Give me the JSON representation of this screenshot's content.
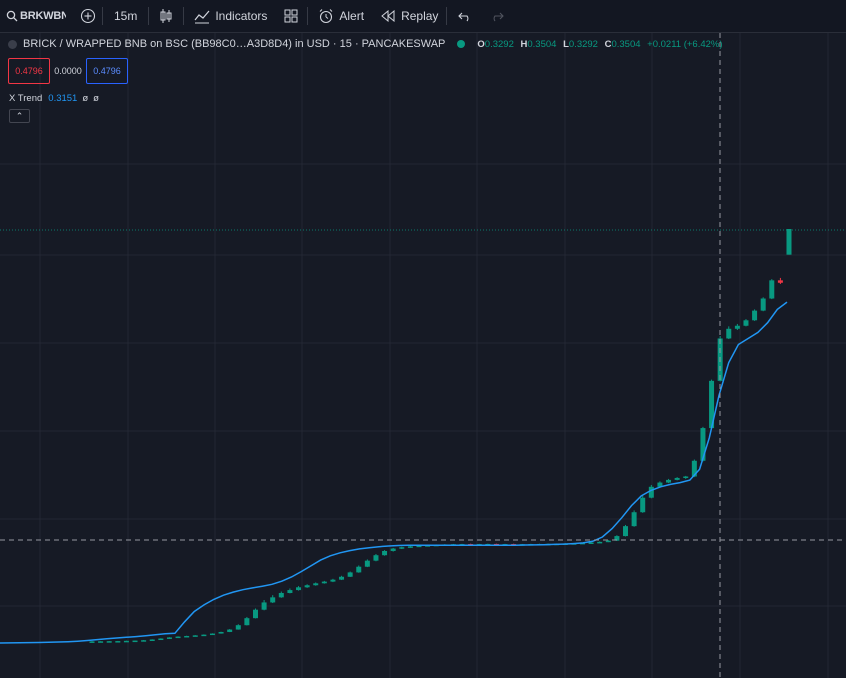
{
  "toolbar": {
    "symbol": "BRKWBNB",
    "interval": "15m",
    "indicators_label": "Indicators",
    "alert_label": "Alert",
    "replay_label": "Replay"
  },
  "legend": {
    "title": "BRICK / WRAPPED BNB on BSC (BB98C0…A3D8D4) in USD · 15 · PANCAKESWAP",
    "open_key": "O",
    "open": "0.3292",
    "high_key": "H",
    "high": "0.3504",
    "low_key": "L",
    "low": "0.3292",
    "close_key": "C",
    "close": "0.3504",
    "change": "+0.0211 (+6.42%)"
  },
  "trade": {
    "sell_price": "0.4796",
    "spread": "0.0000",
    "buy_price": "0.4796"
  },
  "indicator": {
    "name": "X Trend",
    "value": "0.3151",
    "extra1": "ø",
    "extra2": "ø"
  },
  "colors": {
    "up": "#089981",
    "down": "#f23645",
    "trend": "#2196f3",
    "background": "#161a25",
    "grid": "#232733"
  },
  "chart_data": {
    "type": "line",
    "x_unit": "15-minute bars",
    "series": [
      {
        "kind": "candlestick",
        "values": [
          [
            0.0095,
            0.01,
            0.0093,
            0.0098
          ],
          [
            0.0098,
            0.01,
            0.0096,
            0.0099
          ],
          [
            0.0099,
            0.0101,
            0.0097,
            0.01
          ],
          [
            0.01,
            0.0102,
            0.0098,
            0.0101
          ],
          [
            0.0101,
            0.0104,
            0.01,
            0.0103
          ],
          [
            0.0103,
            0.0106,
            0.0102,
            0.0105
          ],
          [
            0.0105,
            0.011,
            0.0104,
            0.0108
          ],
          [
            0.0108,
            0.0116,
            0.0107,
            0.0114
          ],
          [
            0.0114,
            0.0124,
            0.0113,
            0.0122
          ],
          [
            0.0122,
            0.0133,
            0.0121,
            0.0131
          ],
          [
            0.0131,
            0.014,
            0.013,
            0.0138
          ],
          [
            0.0138,
            0.0145,
            0.0137,
            0.0143
          ],
          [
            0.0143,
            0.015,
            0.0142,
            0.0148
          ],
          [
            0.0148,
            0.0156,
            0.0147,
            0.0154
          ],
          [
            0.0154,
            0.0165,
            0.0153,
            0.0163
          ],
          [
            0.0163,
            0.0178,
            0.0162,
            0.0176
          ],
          [
            0.0176,
            0.02,
            0.0175,
            0.0196
          ],
          [
            0.0196,
            0.024,
            0.0195,
            0.0232
          ],
          [
            0.0232,
            0.03,
            0.023,
            0.029
          ],
          [
            0.029,
            0.037,
            0.0288,
            0.036
          ],
          [
            0.036,
            0.044,
            0.0355,
            0.042
          ],
          [
            0.042,
            0.048,
            0.0415,
            0.0462
          ],
          [
            0.0462,
            0.051,
            0.0458,
            0.0498
          ],
          [
            0.0498,
            0.0535,
            0.0495,
            0.0522
          ],
          [
            0.0522,
            0.0555,
            0.0518,
            0.0545
          ],
          [
            0.0545,
            0.057,
            0.054,
            0.0562
          ],
          [
            0.0562,
            0.0585,
            0.0558,
            0.0578
          ],
          [
            0.0578,
            0.0598,
            0.0575,
            0.0592
          ],
          [
            0.0592,
            0.0615,
            0.0588,
            0.0608
          ],
          [
            0.0608,
            0.064,
            0.0605,
            0.0632
          ],
          [
            0.0632,
            0.0675,
            0.063,
            0.0668
          ],
          [
            0.0668,
            0.0725,
            0.0665,
            0.0715
          ],
          [
            0.0715,
            0.0775,
            0.0712,
            0.0765
          ],
          [
            0.0765,
            0.082,
            0.076,
            0.081
          ],
          [
            0.081,
            0.0852,
            0.0806,
            0.0845
          ],
          [
            0.0845,
            0.087,
            0.084,
            0.0865
          ],
          [
            0.0865,
            0.088,
            0.0861,
            0.0876
          ],
          [
            0.0876,
            0.0887,
            0.0872,
            0.0883
          ],
          [
            0.0883,
            0.0892,
            0.088,
            0.0889
          ],
          [
            0.0889,
            0.0896,
            0.0886,
            0.0893
          ],
          [
            0.0893,
            0.0899,
            0.089,
            0.0896
          ],
          [
            0.0896,
            0.0901,
            0.0894,
            0.0899
          ],
          [
            0.0899,
            0.0903,
            0.0896,
            0.0901
          ],
          [
            0.0901,
            0.0904,
            0.0898,
            0.0902
          ],
          [
            0.0902,
            0.0905,
            0.0899,
            0.09
          ],
          [
            0.09,
            0.0904,
            0.0898,
            0.0902
          ],
          [
            0.0902,
            0.0905,
            0.09,
            0.0903
          ],
          [
            0.0903,
            0.0905,
            0.09,
            0.0901
          ],
          [
            0.0901,
            0.0904,
            0.0899,
            0.0902
          ],
          [
            0.0902,
            0.0905,
            0.0899,
            0.09
          ],
          [
            0.09,
            0.0903,
            0.0898,
            0.0901
          ],
          [
            0.0901,
            0.0904,
            0.0899,
            0.0902
          ],
          [
            0.0902,
            0.0905,
            0.09,
            0.0903
          ],
          [
            0.0903,
            0.0906,
            0.0901,
            0.0904
          ],
          [
            0.0904,
            0.0907,
            0.0902,
            0.0905
          ],
          [
            0.0905,
            0.0909,
            0.0903,
            0.0907
          ],
          [
            0.0907,
            0.0911,
            0.0905,
            0.0909
          ],
          [
            0.0909,
            0.0914,
            0.0907,
            0.0912
          ],
          [
            0.0912,
            0.0918,
            0.091,
            0.0915
          ],
          [
            0.0915,
            0.0924,
            0.0913,
            0.092
          ],
          [
            0.092,
            0.0935,
            0.0918,
            0.093
          ],
          [
            0.093,
            0.0975,
            0.0928,
            0.0968
          ],
          [
            0.0968,
            0.106,
            0.0965,
            0.105
          ],
          [
            0.105,
            0.118,
            0.1045,
            0.1165
          ],
          [
            0.1165,
            0.13,
            0.116,
            0.1285
          ],
          [
            0.1285,
            0.139,
            0.128,
            0.1375
          ],
          [
            0.1375,
            0.142,
            0.137,
            0.141
          ],
          [
            0.141,
            0.144,
            0.1405,
            0.1432
          ],
          [
            0.1432,
            0.1455,
            0.1428,
            0.1448
          ],
          [
            0.1448,
            0.1465,
            0.144,
            0.146
          ],
          [
            0.146,
            0.16,
            0.1455,
            0.159
          ],
          [
            0.159,
            0.187,
            0.1585,
            0.186
          ],
          [
            0.186,
            0.226,
            0.1855,
            0.225
          ],
          [
            0.225,
            0.262,
            0.2245,
            0.26
          ],
          [
            0.26,
            0.27,
            0.2595,
            0.268
          ],
          [
            0.268,
            0.272,
            0.267,
            0.2705
          ],
          [
            0.2705,
            0.276,
            0.27,
            0.275
          ],
          [
            0.275,
            0.284,
            0.2745,
            0.283
          ],
          [
            0.283,
            0.294,
            0.2825,
            0.293
          ],
          [
            0.293,
            0.309,
            0.2925,
            0.308
          ],
          [
            0.308,
            0.31,
            0.305,
            0.306
          ],
          [
            0.3292,
            0.3504,
            0.3292,
            0.3504
          ]
        ]
      },
      {
        "kind": "line",
        "name": "X Trend",
        "values": [
          0.0085,
          0.0086,
          0.0087,
          0.0088,
          0.0089,
          0.0091,
          0.0093,
          0.0096,
          0.01,
          0.0106,
          0.0113,
          0.012,
          0.0126,
          0.0132,
          0.0138,
          0.0145,
          0.0153,
          0.0162,
          0.0165,
          0.026,
          0.0345,
          0.04,
          0.0445,
          0.048,
          0.0505,
          0.0525,
          0.054,
          0.0554,
          0.057,
          0.0595,
          0.063,
          0.0675,
          0.0722,
          0.077,
          0.0805,
          0.083,
          0.0848,
          0.0862,
          0.0872,
          0.088,
          0.0886,
          0.089,
          0.0892,
          0.0893,
          0.0893,
          0.0893,
          0.0893,
          0.0893,
          0.0893,
          0.0893,
          0.0892,
          0.0892,
          0.0892,
          0.0893,
          0.0894,
          0.0895,
          0.0897,
          0.0899,
          0.0902,
          0.0906,
          0.0912,
          0.0925,
          0.096,
          0.103,
          0.112,
          0.122,
          0.13,
          0.1345,
          0.1375,
          0.1395,
          0.141,
          0.143,
          0.152,
          0.178,
          0.213,
          0.24,
          0.255,
          0.26,
          0.265,
          0.273,
          0.284,
          0.29
        ]
      }
    ],
    "ylim": [
      0.0,
      0.4
    ]
  }
}
